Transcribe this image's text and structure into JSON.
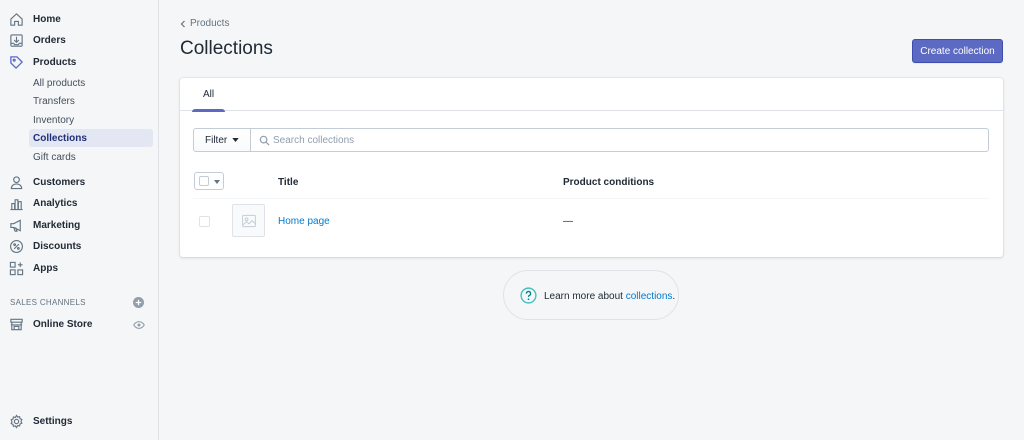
{
  "sidebar": {
    "items": [
      {
        "label": "Home",
        "icon": "home-icon"
      },
      {
        "label": "Orders",
        "icon": "orders-icon"
      },
      {
        "label": "Products",
        "icon": "tag-icon"
      },
      {
        "label": "Customers",
        "icon": "person-icon"
      },
      {
        "label": "Analytics",
        "icon": "bar-chart-icon"
      },
      {
        "label": "Marketing",
        "icon": "megaphone-icon"
      },
      {
        "label": "Discounts",
        "icon": "discount-icon"
      },
      {
        "label": "Apps",
        "icon": "apps-icon"
      }
    ],
    "sub_items": [
      {
        "label": "All products"
      },
      {
        "label": "Transfers"
      },
      {
        "label": "Inventory"
      },
      {
        "label": "Collections",
        "active": true
      },
      {
        "label": "Gift cards"
      }
    ],
    "sales_channels_label": "SALES CHANNELS",
    "online_store_label": "Online Store",
    "settings_label": "Settings"
  },
  "header": {
    "breadcrumb": "Products",
    "title": "Collections",
    "create_button": "Create collection"
  },
  "tabs": [
    {
      "label": "All",
      "active": true
    }
  ],
  "filter": {
    "filter_label": "Filter",
    "search_placeholder": "Search collections",
    "search_value": ""
  },
  "table": {
    "columns": [
      "Title",
      "Product conditions"
    ],
    "rows": [
      {
        "title": "Home page",
        "conditions": "—"
      }
    ]
  },
  "help": {
    "text": "Learn more about ",
    "link": "collections",
    "suffix": "."
  },
  "colors": {
    "accent": "#5c6ac4",
    "link": "#007ace",
    "help_icon": "#47c1bf"
  }
}
